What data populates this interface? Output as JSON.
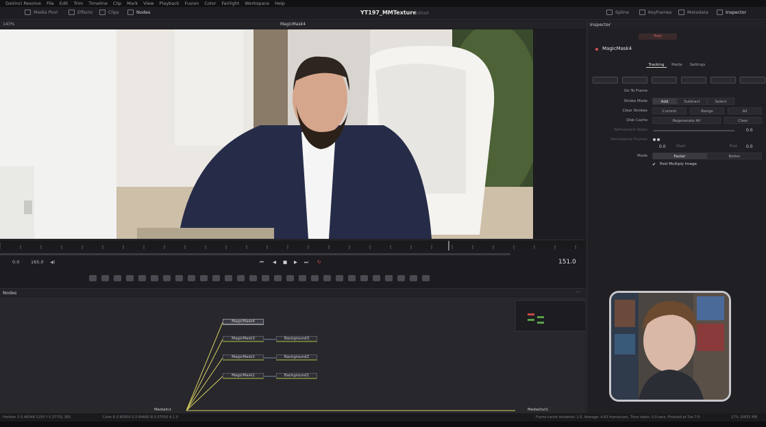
{
  "menubar": {
    "items": [
      "DaVinci Resolve",
      "File",
      "Edit",
      "Trim",
      "Timeline",
      "Clip",
      "Mark",
      "View",
      "Playback",
      "Fusion",
      "Color",
      "Fairlight",
      "Workspace",
      "Help"
    ]
  },
  "toolbar": {
    "media_pool": "Media Pool",
    "effects": "Effects",
    "clips": "Clips",
    "nodes": "Nodes",
    "project_title": "YT197_MMTexture",
    "project_status": "Edited",
    "spline": "Spline",
    "keyframes": "Keyframes",
    "metadata": "Metadata",
    "inspector": "Inspector"
  },
  "viewer": {
    "zoom": "143%",
    "title": "MagicMask4"
  },
  "transport": {
    "start": "0.0",
    "end": "165.0",
    "current_frame": "151.0"
  },
  "nodes_panel": {
    "label": "Nodes",
    "nodes": {
      "magicmask4": "MagicMask4",
      "magicmask3": "MagicMask3",
      "magicmask2": "MagicMask2",
      "magicmask1": "MagicMask1",
      "background3": "Background3",
      "background2": "Background2",
      "background1": "Background1",
      "mediain": "MediaIn1",
      "mediaout": "MediaOut1"
    }
  },
  "status_bar": {
    "position": "Position  X 0.46548    1150    Y 0.37701    383",
    "color": "Color  R 0.80000   G 0.64660   B 0.57550   A 1.0",
    "playback": "Frame cache rendered: 1.0,  Average: 4.63 frames/sec,  Time taken: 0.0 secs,  Finished at Tue 7:0",
    "memory": "17%   10833 MB"
  },
  "inspector": {
    "header": "Inspector",
    "tool_tab": "Tools",
    "node_name": "MagicMask4",
    "tabs": [
      "Tracking",
      "Matte",
      "Settings"
    ],
    "goto_frame": "Go To Frame",
    "stroke_mode": {
      "label": "Stroke Mode",
      "options": [
        "Add",
        "Subtract",
        "Select"
      ]
    },
    "clear_strokes": {
      "label": "Clear Strokes",
      "options": [
        "Current",
        "Range",
        "All"
      ]
    },
    "disk_cache": {
      "label": "Disk Cache",
      "options": [
        "Regenerate All",
        "Clear"
      ]
    },
    "dim1": "Refinement Steps",
    "dim2": "Persistence Frames",
    "slider_val": "0.0",
    "start_val": "0.0",
    "start_lbl": "Start",
    "end_lbl": "End",
    "end_val": "0.0",
    "mode": {
      "label": "Mode",
      "options": [
        "Faster",
        "Better"
      ]
    },
    "post_multiply": "Post Multiply Image"
  },
  "colors": {
    "accent_red": "#d85050",
    "node_green": "#6c7a3a",
    "wire_yellow": "#d8d060"
  }
}
